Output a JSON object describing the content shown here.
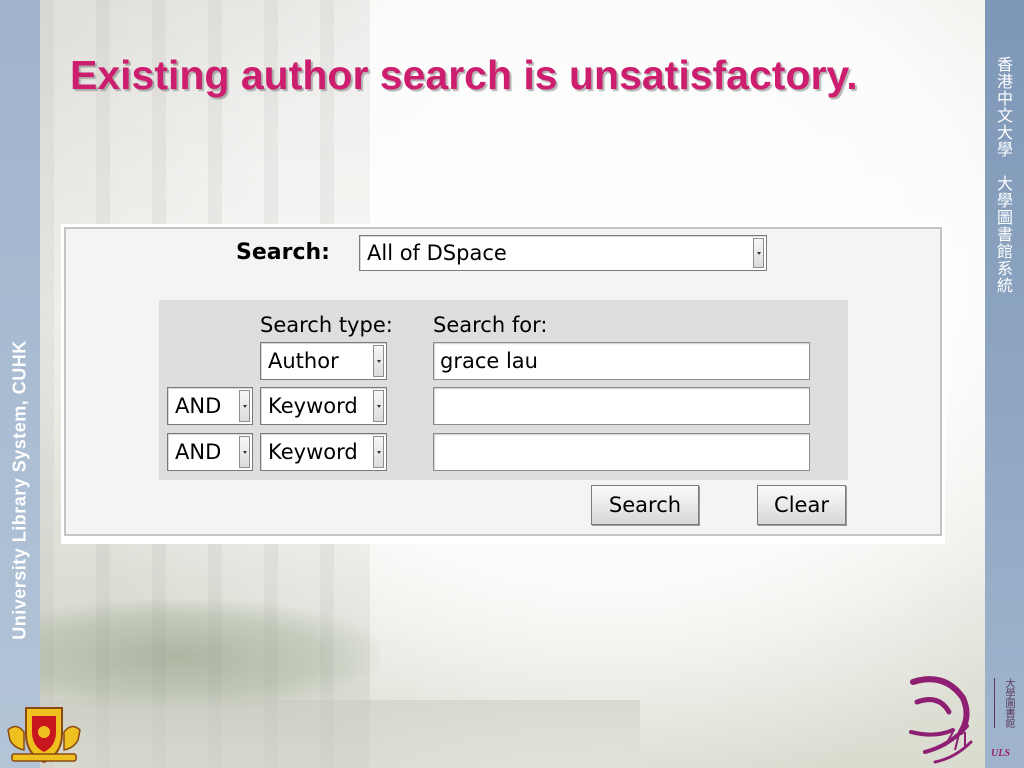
{
  "slide": {
    "title": "Existing author search is unsatisfactory.",
    "left_band_text": "University Library System, CUHK",
    "right_band_text": "香港中文大學　大學圖書館系統",
    "uls_vertical": "大學圖書館",
    "uls_label": "ULS"
  },
  "search_form": {
    "scope_label": "Search:",
    "scope_value": "All of DSpace",
    "search_type_header": "Search type:",
    "search_for_header": "Search for:",
    "rows": [
      {
        "boolean": "",
        "type": "Author",
        "value": "grace lau"
      },
      {
        "boolean": "AND",
        "type": "Keyword",
        "value": ""
      },
      {
        "boolean": "AND",
        "type": "Keyword",
        "value": ""
      }
    ],
    "search_button": "Search",
    "clear_button": "Clear"
  },
  "colors": {
    "title": "#cc1d6e",
    "left_band": "#a9bcd2",
    "right_band": "#8ea6c2"
  }
}
